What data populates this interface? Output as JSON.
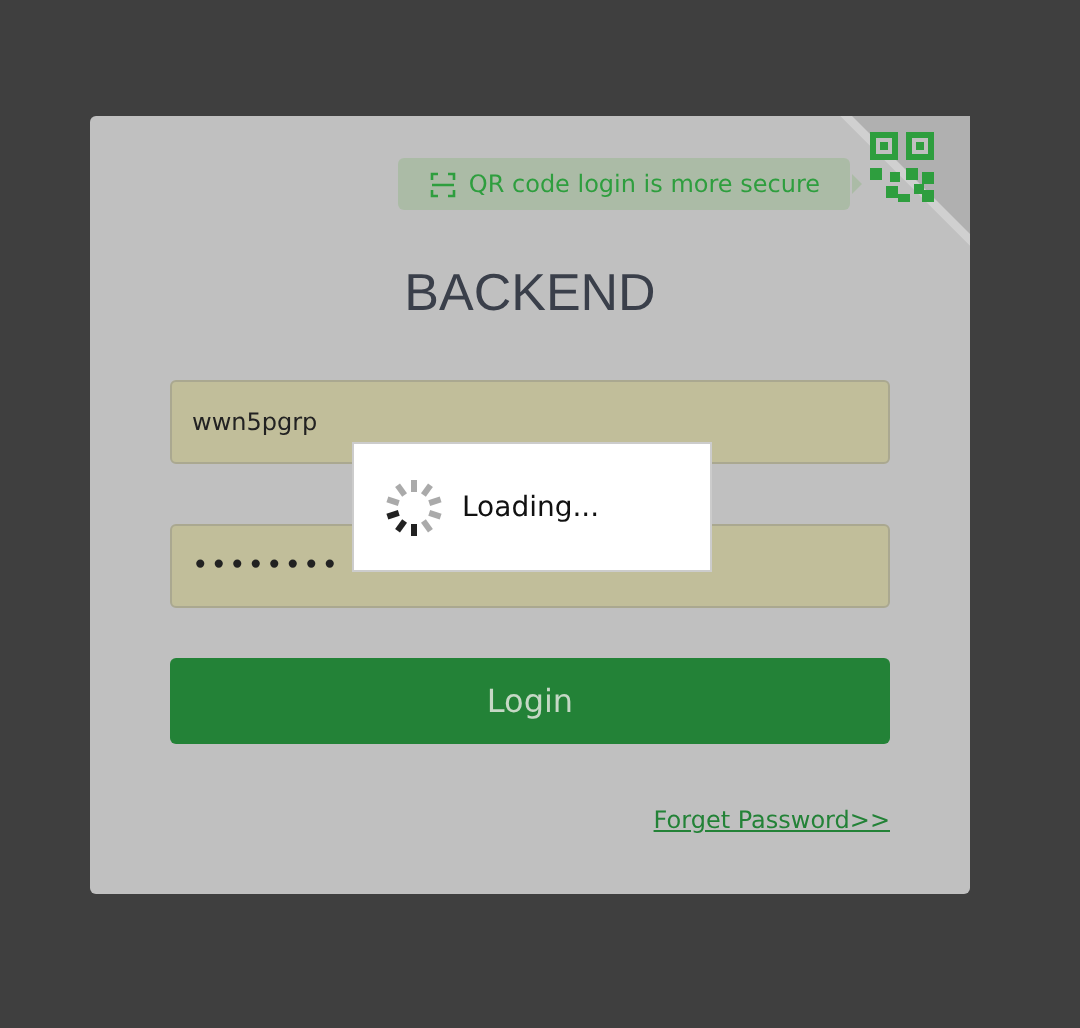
{
  "qr_hint": "QR code login is more secure",
  "title": "BACKEND",
  "username": {
    "value": "wwn5pgrp"
  },
  "password": {
    "value": "••••••••"
  },
  "login_button": "Login",
  "forget_link": "Forget Password>>",
  "loading": {
    "text": "Loading..."
  }
}
